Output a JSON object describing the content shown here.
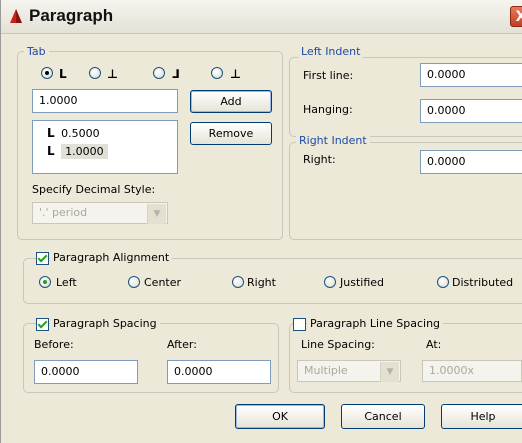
{
  "window": {
    "title": "Paragraph",
    "close_label": "X"
  },
  "tab": {
    "group_label": "Tab",
    "tab_types": [
      {
        "glyph": "L",
        "selected": true
      },
      {
        "glyph": "⊥",
        "selected": false
      },
      {
        "glyph": "⅃",
        "selected": false
      },
      {
        "glyph": "⊥",
        "selected": false
      }
    ],
    "input_value": "1.0000",
    "add_label": "Add",
    "remove_label": "Remove",
    "stops": [
      {
        "glyph": "L",
        "value": "0.5000"
      },
      {
        "glyph": "L",
        "value": "1.0000"
      }
    ],
    "decimal_label": "Specify Decimal Style:",
    "decimal_value": "'.' period"
  },
  "left_indent": {
    "group_label": "Left Indent",
    "first_line_label": "First line:",
    "first_line_value": "0.0000",
    "hanging_label": "Hanging:",
    "hanging_value": "0.0000"
  },
  "right_indent": {
    "group_label": "Right Indent",
    "right_label": "Right:",
    "right_value": "0.0000"
  },
  "alignment": {
    "label": "Paragraph Alignment",
    "checked": true,
    "options": [
      "Left",
      "Center",
      "Right",
      "Justified",
      "Distributed"
    ],
    "selected": "Left"
  },
  "spacing": {
    "label": "Paragraph Spacing",
    "checked": true,
    "before_label": "Before:",
    "before_value": "0.0000",
    "after_label": "After:",
    "after_value": "0.0000"
  },
  "line_spacing": {
    "label": "Paragraph Line Spacing",
    "checked": false,
    "line_spacing_label": "Line Spacing:",
    "line_spacing_value": "Multiple",
    "at_label": "At:",
    "at_value": "1.0000x"
  },
  "buttons": {
    "ok": "OK",
    "cancel": "Cancel",
    "help": "Help"
  },
  "colors": {
    "group_label_blue": "#1c4aa8",
    "dialog_bg": "#ece9d8",
    "radio_dot": "#21a121"
  }
}
